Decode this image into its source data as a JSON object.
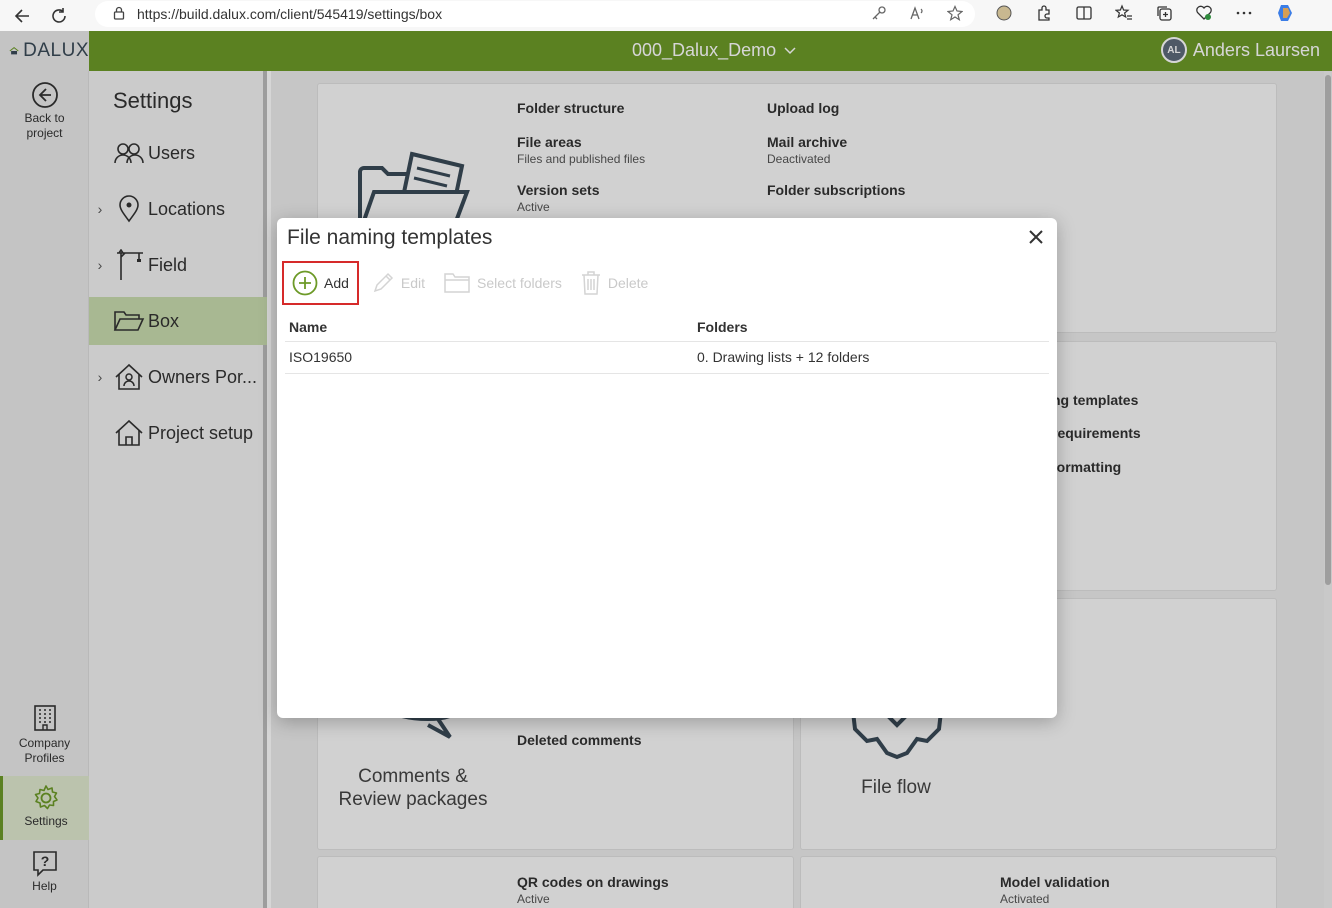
{
  "browser": {
    "url": "https://build.dalux.com/client/545419/settings/box"
  },
  "header": {
    "logo_text": "DALUX",
    "project_name": "000_Dalux_Demo",
    "user_initials": "AL",
    "user_name": "Anders Laursen"
  },
  "rail": {
    "back": "Back to project",
    "company": "Company Profiles",
    "settings": "Settings",
    "help": "Help"
  },
  "sidebar": {
    "title": "Settings",
    "items": [
      {
        "label": "Users",
        "icon": "users-icon"
      },
      {
        "label": "Locations",
        "icon": "location-pin-icon"
      },
      {
        "label": "Field",
        "icon": "crane-icon"
      },
      {
        "label": "Box",
        "icon": "folder-open-icon"
      },
      {
        "label": "Owners Por...",
        "icon": "house-person-icon"
      },
      {
        "label": "Project setup",
        "icon": "house-icon"
      }
    ]
  },
  "cards": {
    "folder_structure": "Folder structure",
    "upload_log": "Upload log",
    "file_areas": "File areas",
    "file_areas_sub": "Files and published files",
    "mail_archive": "Mail archive",
    "mail_archive_sub": "Deactivated",
    "version_sets": "Version sets",
    "version_sets_sub": "Active",
    "folder_subscriptions": "Folder subscriptions",
    "naming_templates_partial": "ng templates",
    "requirements_partial": "requirements",
    "formatting_partial": "formatting",
    "deleted_comments": "Deleted comments",
    "comments_review": "Comments &\nReview packages",
    "file_flow": "File flow",
    "qr_codes": "QR codes on drawings",
    "qr_codes_sub": "Active",
    "model_validation": "Model validation",
    "model_validation_sub": "Activated"
  },
  "modal": {
    "title": "File naming templates",
    "toolbar": {
      "add": "Add",
      "edit": "Edit",
      "select_folders": "Select folders",
      "delete": "Delete"
    },
    "columns": {
      "name": "Name",
      "folders": "Folders"
    },
    "rows": [
      {
        "name": "ISO19650",
        "folders": "0. Drawing lists + 12 folders"
      }
    ]
  },
  "colors": {
    "brand_green": "#6d9a28",
    "highlight_red": "#d62a2a"
  }
}
